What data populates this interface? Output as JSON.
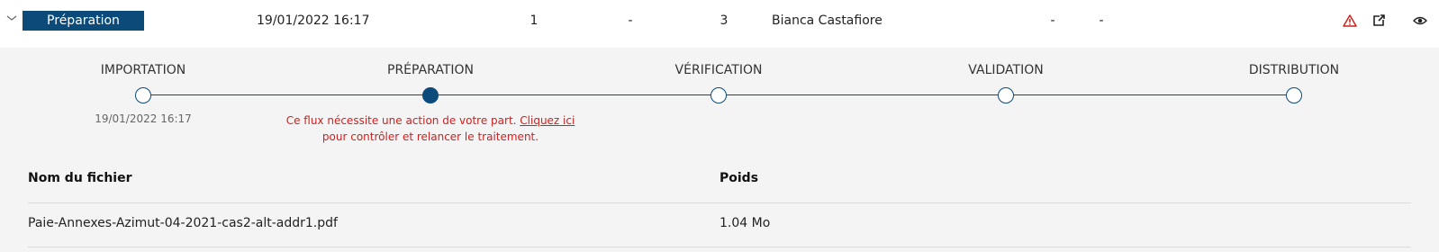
{
  "row": {
    "status": "Préparation",
    "date": "19/01/2022 16:17",
    "count_a": "1",
    "dash_a": "-",
    "count_b": "3",
    "user": "Bianca Castafiore",
    "dash_b": "-",
    "dash_c": "-",
    "icons": [
      "chevron-down-icon",
      "warning-icon",
      "external-link-icon",
      "eye-icon"
    ],
    "colors": {
      "brand": "#0c4a7a",
      "warning": "#d02020"
    }
  },
  "stepper": {
    "steps": [
      {
        "label": "IMPORTATION",
        "state": "done"
      },
      {
        "label": "PRÉPARATION",
        "state": "active"
      },
      {
        "label": "VÉRIFICATION",
        "state": "pending"
      },
      {
        "label": "VALIDATION",
        "state": "pending"
      },
      {
        "label": "DISTRIBUTION",
        "state": "pending"
      }
    ],
    "import_date": "19/01/2022 16:17",
    "message_before": "Ce flux nécessite une action de votre part. ",
    "message_link": "Cliquez ici",
    "message_after": " pour contrôler et relancer le traitement."
  },
  "files": {
    "headers": {
      "name": "Nom du fichier",
      "size": "Poids"
    },
    "rows": [
      {
        "name": "Paie-Annexes-Azimut-04-2021-cas2-alt-addr1.pdf",
        "size": "1.04 Mo"
      }
    ]
  }
}
